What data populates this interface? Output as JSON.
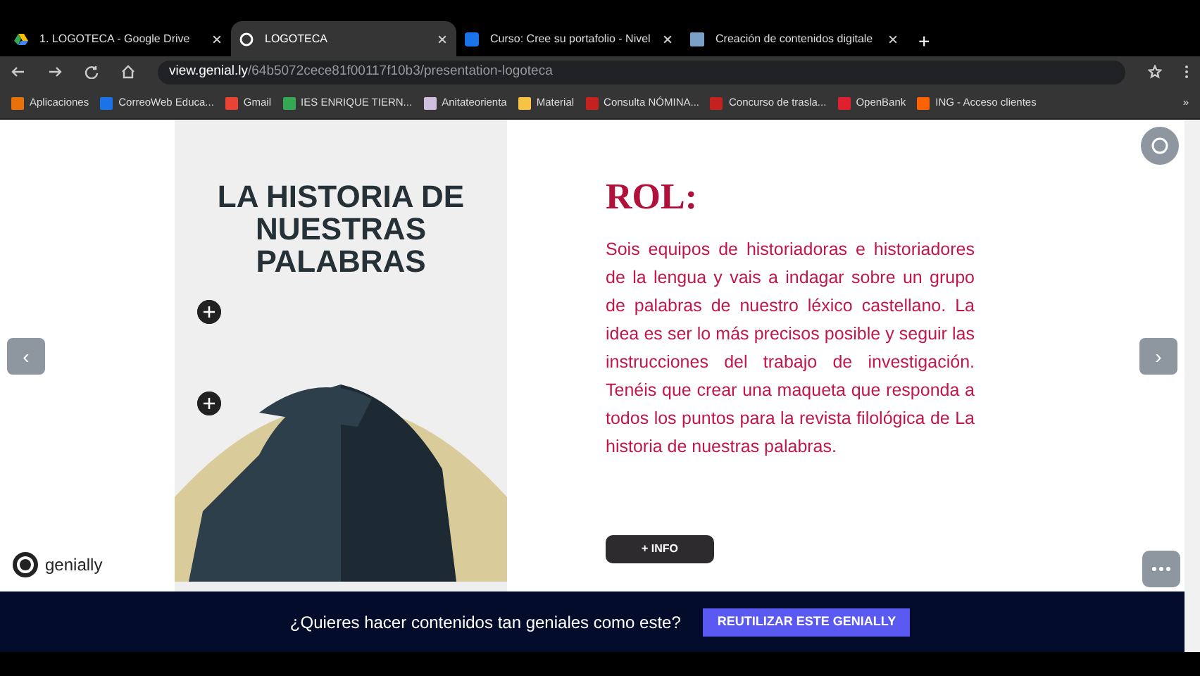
{
  "browser": {
    "tabs": [
      {
        "title": "1. LOGOTECA - Google Drive",
        "selected": false
      },
      {
        "title": "LOGOTECA",
        "selected": true
      },
      {
        "title": "Curso: Cree su portafolio - Nivel",
        "selected": false
      },
      {
        "title": "Creación de contenidos digitale",
        "selected": false
      }
    ],
    "new_tab": "+",
    "url_host": "view.genial.ly",
    "url_path": "/64b5072cece81f00117f10b3/presentation-logoteca",
    "bookmarks": [
      {
        "label": "Aplicaciones",
        "color": "#e8710a"
      },
      {
        "label": "CorreoWeb Educa...",
        "color": "#1a73e8"
      },
      {
        "label": "Gmail",
        "color": "#ea4335"
      },
      {
        "label": "IES ENRIQUE TIERN...",
        "color": "#34a853"
      },
      {
        "label": "Anitateorienta",
        "color": "#d0c0e0"
      },
      {
        "label": "Material",
        "color": "#f6c343"
      },
      {
        "label": "Consulta NÓMINA...",
        "color": "#c5221f"
      },
      {
        "label": "Concurso de trasla...",
        "color": "#c5221f"
      },
      {
        "label": "OpenBank",
        "color": "#e0202e"
      },
      {
        "label": "ING - Acceso clientes",
        "color": "#ff6200"
      }
    ],
    "more": "»"
  },
  "slide": {
    "title": "LA HISTORIA DE NUESTRAS PALABRAS",
    "heading": "ROL:",
    "body": "Sois equipos de historiadoras e historiadores de la lengua y vais a indagar sobre un grupo de palabras de nuestro léxico castellano. La idea es ser lo más precisos posible y seguir las instrucciones del trabajo de investigación. Tenéis que crear una maqueta que responda a todos los puntos para la revista filológica de La historia de nuestras palabras.",
    "info_button": "+ INFO"
  },
  "prev": "‹",
  "next": "›",
  "logo": "genially",
  "banner": {
    "text": "¿Quieres hacer contenidos tan geniales como este?",
    "button": "REUTILIZAR ESTE GENIALLY"
  }
}
